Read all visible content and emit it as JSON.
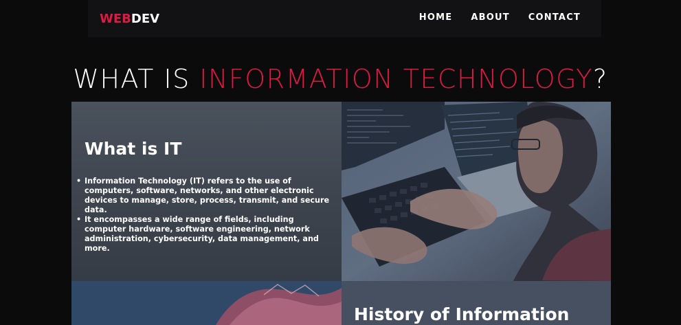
{
  "brand": {
    "accent": "WEB",
    "rest": "DEV"
  },
  "nav": {
    "items": [
      {
        "label": "HOME"
      },
      {
        "label": "ABOUT"
      },
      {
        "label": "CONTACT"
      }
    ]
  },
  "hero": {
    "prefix": "WHAT IS ",
    "highlight": "INFORMATION TECHNOLOGY",
    "suffix": "?"
  },
  "sections": {
    "what_is_it": {
      "title": "What is IT",
      "bullets": [
        "Information Technology (IT) refers to the use of computers, software, networks, and other electronic devices to manage, store, process, transmit, and secure data.",
        "It encompasses a wide range of fields, including computer hardware, software engineering, network administration, cybersecurity, data management, and more."
      ]
    },
    "history": {
      "title": "History of Information"
    }
  },
  "colors": {
    "accent": "#dc1a44",
    "background": "#0b0b0c",
    "card": "#434b56"
  },
  "icons": [
    "laptop-coding-photo",
    "abstract-circuit-photo"
  ]
}
